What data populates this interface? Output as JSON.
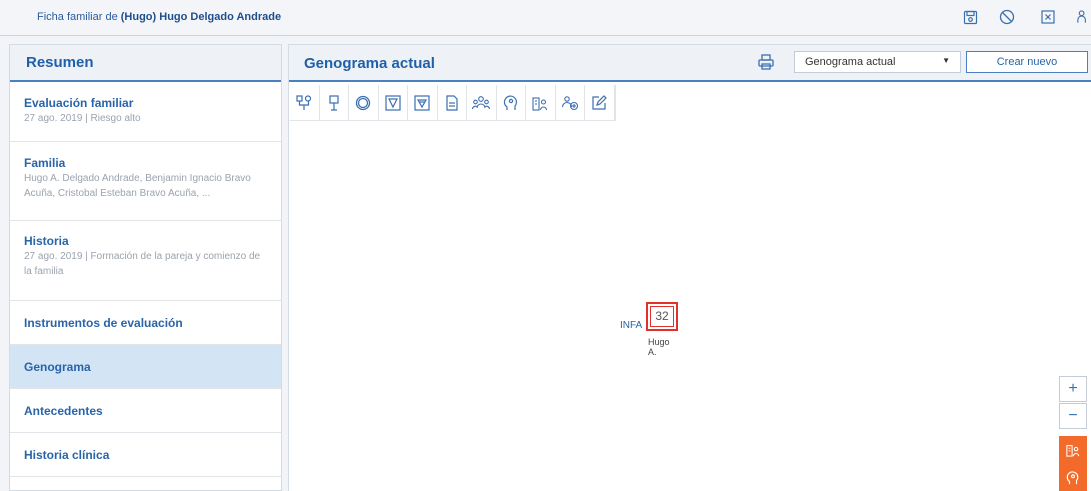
{
  "topbar": {
    "title_prefix": "Ficha familiar de ",
    "title_name": "(Hugo) Hugo Delgado Andrade",
    "icons": [
      "save-icon",
      "cancel-icon",
      "close-box-icon",
      "family-icon"
    ]
  },
  "sidebar": {
    "header": "Resumen",
    "items": [
      {
        "title": "Evaluación familiar",
        "subtitle": "27 ago. 2019 | Riesgo alto"
      },
      {
        "title": "Familia",
        "subtitle": "Hugo A. Delgado Andrade, Benjamin Ignacio Bravo Acuña, Cristobal Esteban Bravo Acuña, ..."
      },
      {
        "title": "Historia",
        "subtitle": "27 ago. 2019 | Formación de la pareja y comienzo de la familia"
      },
      {
        "title": "Instrumentos de evaluación"
      },
      {
        "title": "Genograma"
      },
      {
        "title": "Antecedentes"
      },
      {
        "title": "Historia clínica"
      }
    ]
  },
  "main": {
    "title": "Genograma actual",
    "select_value": "Genograma actual",
    "new_button": "Crear nuevo",
    "tools": [
      "couple-icon",
      "child-icon",
      "circle-icon",
      "triangle-down-icon",
      "triangle-box-icon",
      "document-icon",
      "group-icon",
      "head-icon",
      "building-person-icon",
      "people-add-icon",
      "edit-icon"
    ],
    "node": {
      "label": "INFA",
      "age": "32",
      "name_line1": "Hugo",
      "name_line2": "A."
    },
    "zoom_in": "+",
    "zoom_out": "−",
    "action_icons": [
      "building-person-icon",
      "head-icon",
      "group-icon"
    ]
  },
  "colors": {
    "accent": "#2a64a8",
    "active_row": "#d3e4f5",
    "node_border": "#e0312b",
    "action": "#f26b2a"
  }
}
